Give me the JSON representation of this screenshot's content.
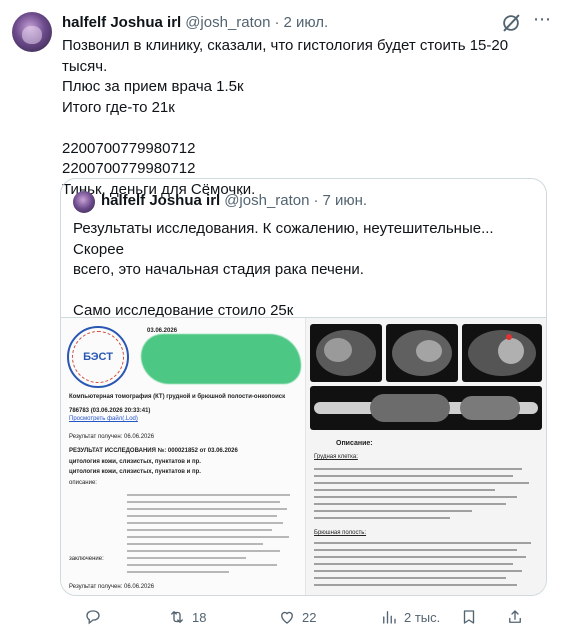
{
  "tweet": {
    "author_name": "halfelf Joshua irl",
    "handle": "@josh_raton",
    "separator": "·",
    "date": "2 июл.",
    "lines": [
      "Позвонил в клинику, сказали, что гистология будет стоить 15-20 тысяч.",
      "Плюс за прием врача 1.5к",
      "Итого где-то 21к",
      "",
      "2200700779980712",
      "2200700779980712",
      "Тиньк, деньги для Сёмочки."
    ]
  },
  "quoted": {
    "author_name": "halfelf Joshua irl",
    "handle": "@josh_raton",
    "separator": "·",
    "date": "7 июн.",
    "lines": [
      "Результаты исследования. К сожалению, неутешительные... Скорее",
      "всего, это начальная стадия рака печени.",
      "",
      "Само исследование стоило 25к",
      "..."
    ],
    "doc": {
      "logo_text": "БЭСТ",
      "date_header": "03.06.2026",
      "exam_title": "Компьютерная томография (КТ) грудной и брюшной полости-онкопоиск",
      "exam_code": "786783 (03.06.2026 20:33:41)",
      "link_text": "Просмотреть файл(.Lod)",
      "received_1": "Результат получен: 06.06.2026",
      "study_header": "РЕЗУЛЬТАТ ИССЛЕДОВАНИЯ №: 000021852 от 03.06.2026",
      "cytology_1": "цитология кожи, слизистых, пунктатов и пр.",
      "cytology_2": "цитология кожи, слизистых, пунктатов и пр.",
      "description_label": "описание:",
      "conclusion_label": "заключение:",
      "received_2": "Результат получен: 06.06.2026"
    },
    "ct": {
      "description_label": "Описание:",
      "chest_label": "Грудная клетка:",
      "abdomen_label": "Брюшная полость:"
    }
  },
  "actions": {
    "reply_count": "",
    "retweet_count": "18",
    "like_count": "22",
    "views_count": "2 тыс."
  },
  "colors": {
    "text": "#0f1419",
    "muted": "#536471",
    "border": "#cfd9de",
    "link_blue": "#2456c8"
  }
}
